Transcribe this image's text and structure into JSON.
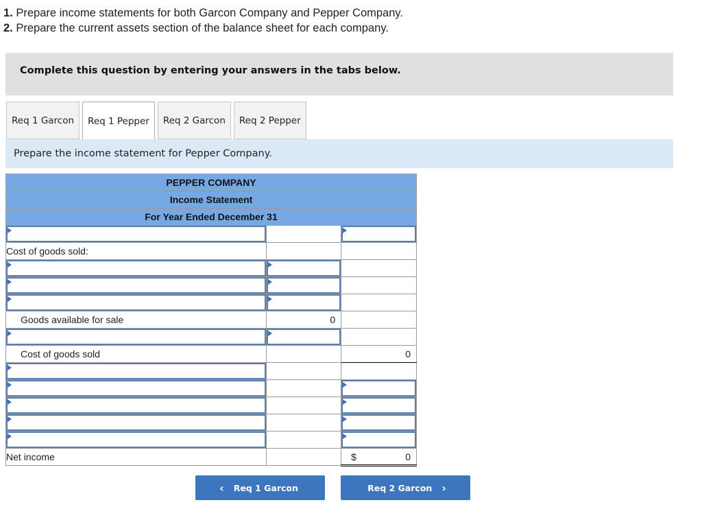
{
  "instructions": [
    {
      "num": "1.",
      "text": " Prepare income statements for both Garcon Company and Pepper Company."
    },
    {
      "num": "2.",
      "text": " Prepare the current assets section of the balance sheet for each company."
    }
  ],
  "banner": "Complete this question by entering your answers in the tabs below.",
  "tabs": [
    {
      "label": "Req 1 Garcon",
      "active": false
    },
    {
      "label": "Req 1 Pepper",
      "active": true
    },
    {
      "label": "Req 2 Garcon",
      "active": false
    },
    {
      "label": "Req 2 Pepper",
      "active": false
    }
  ],
  "subheading": "Prepare the income statement for Pepper Company.",
  "statement": {
    "company": "PEPPER COMPANY",
    "title": "Income Statement",
    "period": "For Year Ended December 31",
    "labels": {
      "cogs_header": "Cost of goods sold:",
      "goods_available": "Goods available for sale",
      "cogs": "Cost of goods sold",
      "net_income": "Net income"
    },
    "values": {
      "goods_available": "0",
      "cogs": "0",
      "net_income_currency": "$",
      "net_income": "0"
    }
  },
  "nav": {
    "prev_label": "Req 1 Garcon",
    "next_label": "Req 2 Garcon",
    "prev_icon": "‹",
    "next_icon": "›"
  }
}
